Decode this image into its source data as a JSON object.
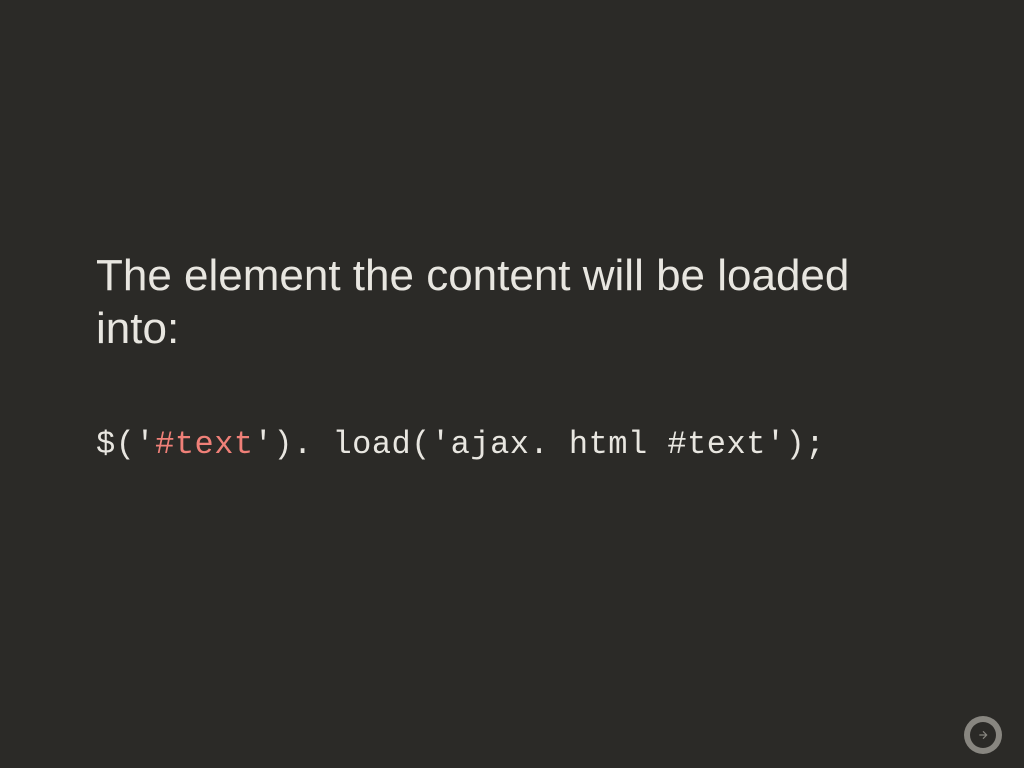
{
  "slide": {
    "heading": "The element the content will be loaded into:",
    "code": {
      "pre": "$('",
      "highlight": "#text",
      "post": "'). load('ajax. html #text');"
    }
  },
  "controls": {
    "next_icon": "arrow-right"
  }
}
